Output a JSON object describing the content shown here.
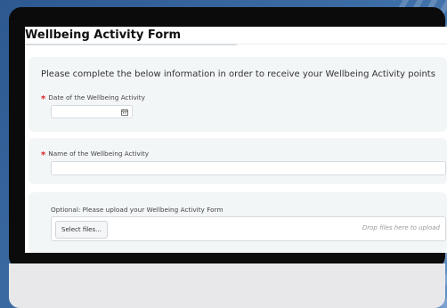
{
  "form": {
    "title": "Wellbeing Activity Form",
    "intro": "Please complete the below information in order to receive your Wellbeing Activity points",
    "date_field": {
      "label": "Date of the Wellbeing Activity",
      "required_mark": "*",
      "value": "",
      "icon": "calendar-icon"
    },
    "name_field": {
      "label": "Name of the Wellbeing Activity",
      "required_mark": "*",
      "value": ""
    },
    "upload_field": {
      "label": "Optional: Please upload your Wellbeing Activity Form",
      "button_label": "Select files...",
      "drop_text": "Drop files here to upload"
    }
  },
  "colors": {
    "background": "#3f6fa7",
    "bezel": "#0b0b0b",
    "card": "#f3f6f7",
    "required": "#d81e1e"
  }
}
